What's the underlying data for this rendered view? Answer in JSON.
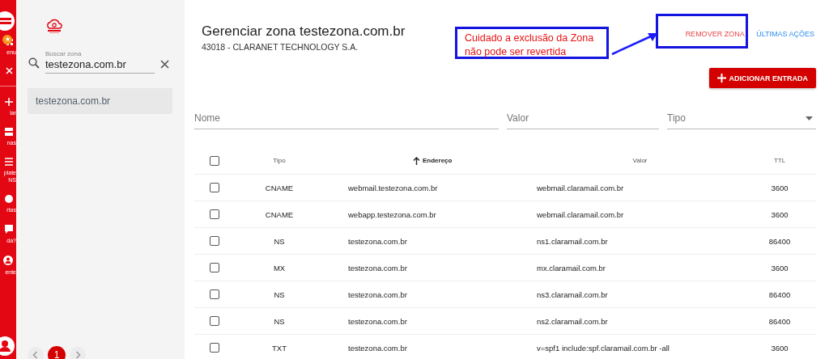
{
  "rail": {
    "badge": "★",
    "labels": [
      "enu",
      "iar",
      "nas",
      "plate NS",
      "rtas",
      "da?",
      "ente"
    ]
  },
  "sidebar": {
    "search": {
      "label": "Buscar zona",
      "value": "testezona.com.br"
    },
    "zones": [
      {
        "label": "testezona.com.br",
        "selected": true
      }
    ],
    "pagination": {
      "pages": [
        {
          "label": "1",
          "selected": true
        }
      ]
    }
  },
  "header": {
    "title": "Gerenciar zona testezona.com.br",
    "subtitle": "43018 - CLARANET TECHNOLOGY S.A.",
    "actions": [
      {
        "label": "REMOVER ZONA",
        "kind": "danger"
      },
      {
        "label": "ÚLTIMAS AÇÕES",
        "kind": "info"
      }
    ],
    "add_button": "ADICIONAR ENTRADA"
  },
  "annotation": {
    "text": "Cuidado a exclusão da Zona não pode ser revertida"
  },
  "filters": [
    {
      "placeholder": "Nome",
      "kind": "text"
    },
    {
      "placeholder": "Valor",
      "kind": "text"
    },
    {
      "placeholder": "Tipo",
      "kind": "select"
    }
  ],
  "table": {
    "columns": [
      {
        "label": "Tipo",
        "sorted": false
      },
      {
        "label": "Endereço",
        "sorted": true
      },
      {
        "label": "Valor",
        "sorted": false
      },
      {
        "label": "TTL",
        "sorted": false
      }
    ],
    "all_checked": false,
    "rows": [
      {
        "checked": false,
        "cells": [
          "CNAME",
          "webmail.testezona.com.br",
          "webmail.claramail.com.br",
          "3600"
        ]
      },
      {
        "checked": false,
        "cells": [
          "CNAME",
          "webapp.testezona.com.br",
          "webmail.claramail.com.br",
          "3600"
        ]
      },
      {
        "checked": false,
        "cells": [
          "NS",
          "testezona.com.br",
          "ns1.claramail.com.br",
          "86400"
        ]
      },
      {
        "checked": false,
        "cells": [
          "MX",
          "testezona.com.br",
          "mx.claramail.com.br",
          "3600"
        ]
      },
      {
        "checked": false,
        "cells": [
          "NS",
          "testezona.com.br",
          "ns3.claramail.com.br",
          "86400"
        ]
      },
      {
        "checked": false,
        "cells": [
          "NS",
          "testezona.com.br",
          "ns2.claramail.com.br",
          "86400"
        ]
      },
      {
        "checked": false,
        "cells": [
          "TXT",
          "testezona.com.br",
          "v=spf1 include:spf.claramail.com.br -all",
          "3600"
        ]
      }
    ]
  }
}
